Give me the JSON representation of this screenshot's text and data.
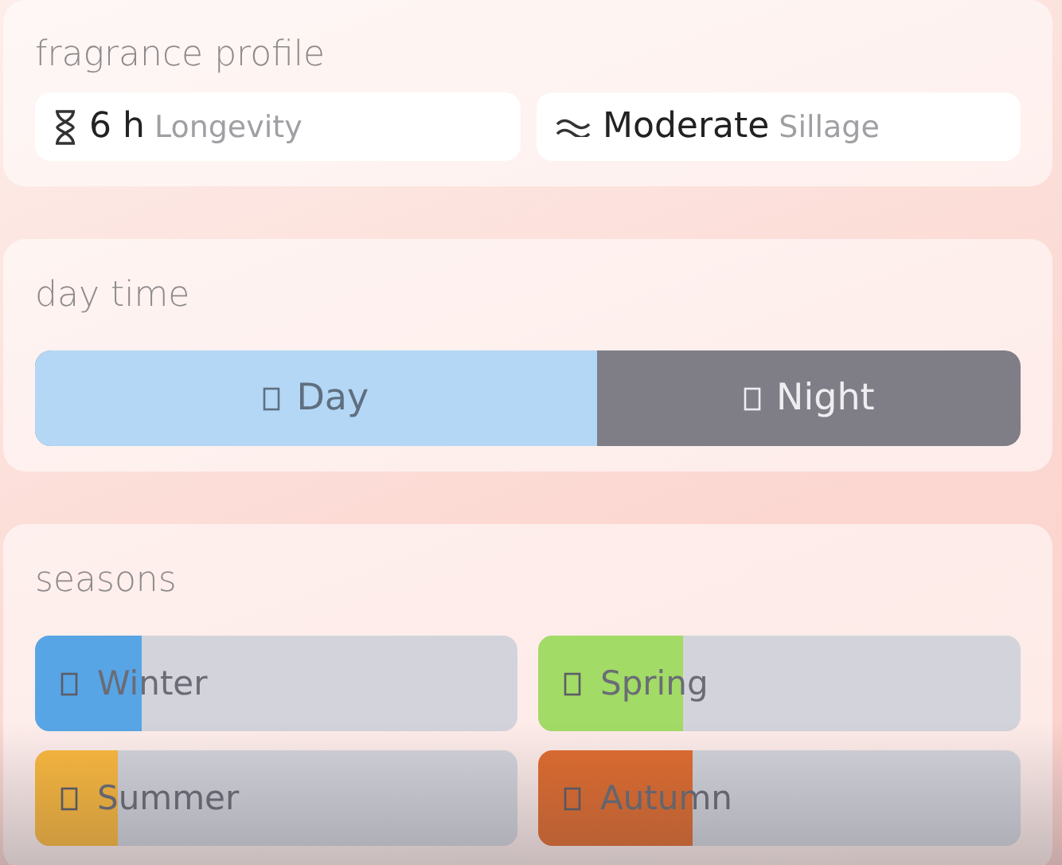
{
  "fragrance_profile": {
    "title": "fragrance profile",
    "stats": [
      {
        "kind": "longevity",
        "value": "6 h",
        "label": "Longevity"
      },
      {
        "kind": "sillage",
        "value": "Moderate",
        "label": "Sillage"
      }
    ]
  },
  "day_time": {
    "title": "day time",
    "level": 0.57,
    "segments": [
      {
        "label": "Day",
        "color": "#b3d7f5"
      },
      {
        "label": "Night",
        "color": "#7f7e87"
      }
    ]
  },
  "seasons": {
    "title": "seasons",
    "items": [
      {
        "label": "Winter",
        "level": 0.22,
        "color": "#58a5e6"
      },
      {
        "label": "Spring",
        "level": 0.3,
        "color": "#a2db66"
      },
      {
        "label": "Summer",
        "level": 0.17,
        "color": "#fbb83d"
      },
      {
        "label": "Autumn",
        "level": 0.32,
        "color": "#e06c2f"
      }
    ]
  }
}
